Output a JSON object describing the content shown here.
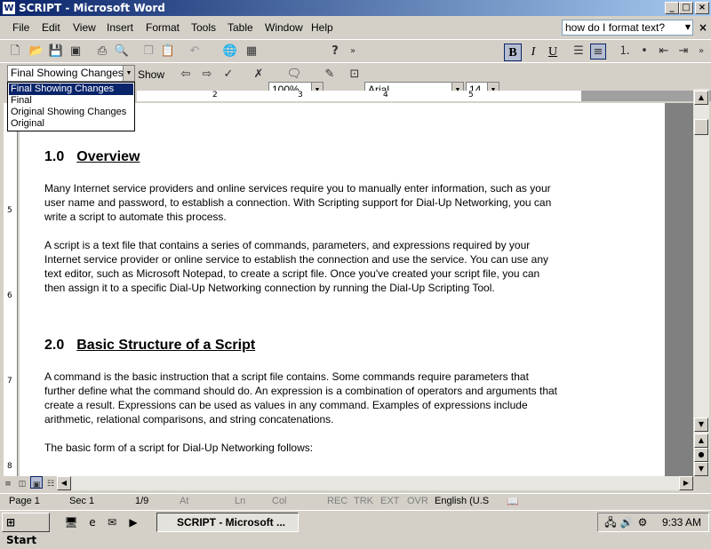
{
  "window": {
    "title": "SCRIPT - Microsoft Word",
    "app_icon": "word-icon"
  },
  "menu": [
    "File",
    "Edit",
    "View",
    "Insert",
    "Format",
    "Tools",
    "Table",
    "Window",
    "Help"
  ],
  "ask": {
    "value": "how do I format text?"
  },
  "standard_toolbar": {
    "zoom": "100%",
    "help_icon": "?"
  },
  "formatting": {
    "font": "Arial",
    "size": "14",
    "bold": "B",
    "italic": "I",
    "underline": "U"
  },
  "reviewing": {
    "display_value": "Final Showing Changes",
    "show_label": "Show",
    "dropdown_options": [
      "Final Showing Changes",
      "Final",
      "Original Showing Changes",
      "Original"
    ],
    "selected_index": 0
  },
  "ruler": {
    "numbers": [
      "2",
      "3",
      "4",
      "5"
    ],
    "vnumbers": [
      "5",
      "6",
      "7",
      "8"
    ]
  },
  "document": {
    "h1": {
      "number": "1.0",
      "title": "Overview"
    },
    "p1": "Many Internet service providers and online services require you to manually enter information, such as your user name and password, to establish a connection. With Scripting support for Dial-Up Networking, you can write a script to automate this process.",
    "p2": "A script is a text file that contains a series of commands, parameters, and expressions required by your Internet service provider or online service to establish the connection and use the service. You can use any text editor, such as Microsoft Notepad, to create a script file. Once you've created your script file, you can then assign it to a specific Dial-Up Networking connection by running the Dial-Up Scripting Tool.",
    "h2": {
      "number": "2.0",
      "title": "Basic Structure of a Script"
    },
    "p3": "A command is the basic instruction that a script file contains. Some commands require parameters that further define what the command should do. An expression is a combination of operators and arguments that create a result. Expressions can be used as values in any command.  Examples of expressions include arithmetic, relational comparisons, and string concatenations.",
    "p4": "The basic form of a script for Dial-Up Networking follows:"
  },
  "status": {
    "page": "Page  1",
    "sec": "Sec  1",
    "pages": "1/9",
    "at": "At",
    "ln": "Ln",
    "col": "Col",
    "rec": "REC",
    "trk": "TRK",
    "ext": "EXT",
    "ovr": "OVR",
    "language": "English (U.S"
  },
  "taskbar": {
    "start": "Start",
    "task": "SCRIPT - Microsoft ...",
    "time": "9:33 AM"
  },
  "colors": {
    "title_start": "#0a246a",
    "title_end": "#a6caf0",
    "selection": "#0a246a"
  }
}
